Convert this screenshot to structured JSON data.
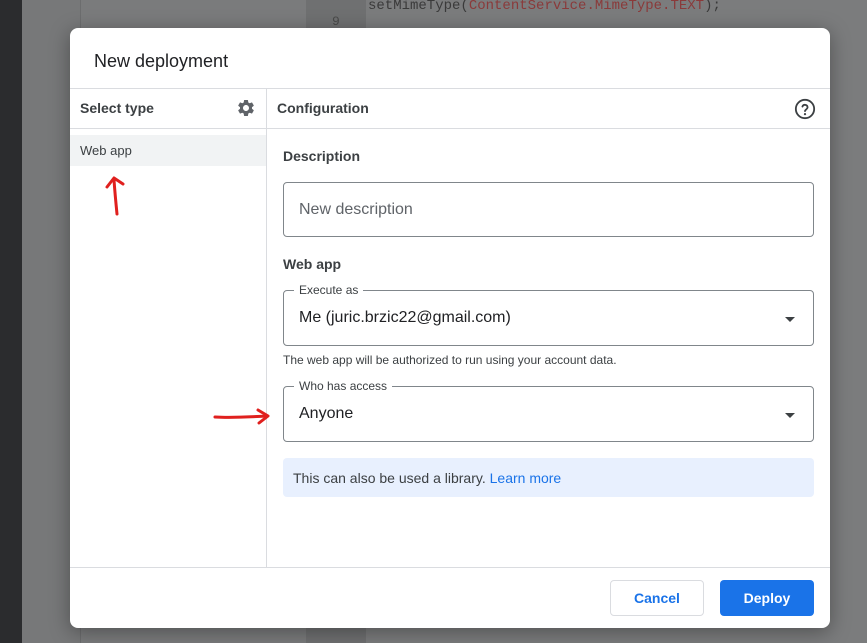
{
  "background": {
    "code_line": "setMimeType(ContentService.MimeType.TEXT);",
    "code_prefix": "setMimeType(",
    "code_class": "ContentService.MimeType.TEXT",
    "code_suffix": ");",
    "line_number": "9"
  },
  "dialog": {
    "title": "New deployment",
    "left_panel": {
      "header": "Select type",
      "items": [
        {
          "label": "Web app",
          "selected": true
        }
      ]
    },
    "right_panel": {
      "header": "Configuration",
      "description_section": "Description",
      "description_placeholder": "New description",
      "web_app_section": "Web app",
      "execute_as": {
        "label": "Execute as",
        "value": "Me (juric.brzic22@gmail.com)"
      },
      "execute_hint": "The web app will be authorized to run using your account data.",
      "who_has_access": {
        "label": "Who has access",
        "value": "Anyone"
      },
      "info": {
        "text": "This can also be used a library.",
        "link": "Learn more"
      }
    },
    "buttons": {
      "cancel": "Cancel",
      "deploy": "Deploy"
    }
  },
  "colors": {
    "primary": "#1a73e8",
    "info_bg": "#e8f0fe",
    "annotation_red": "#e0201e"
  }
}
